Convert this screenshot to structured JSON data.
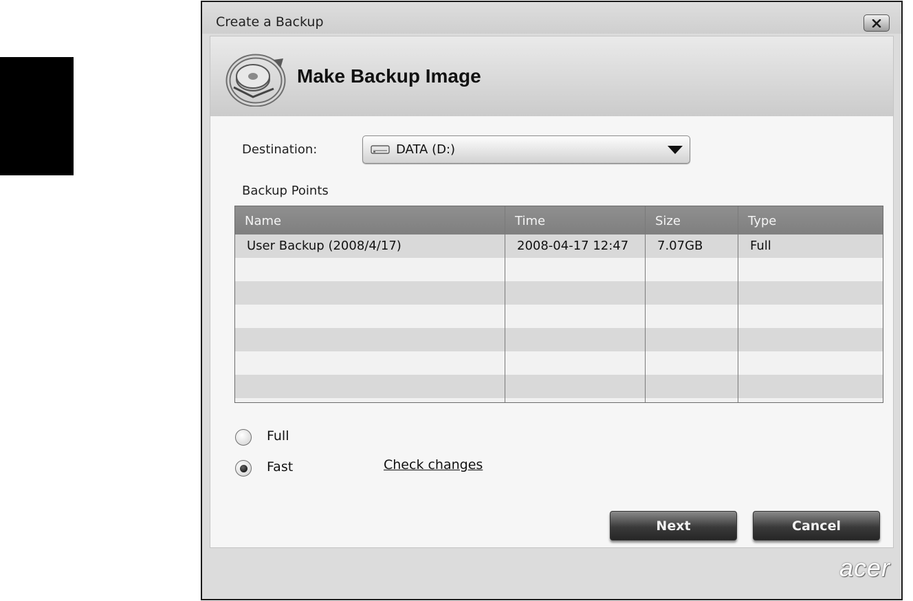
{
  "window": {
    "title": "Create a Backup",
    "close_icon": "close-x-icon"
  },
  "header": {
    "title": "Make Backup Image",
    "icon": "backup-disk-icon"
  },
  "destination": {
    "label": "Destination:",
    "value": "DATA (D:)",
    "icon": "drive-icon"
  },
  "backup_points": {
    "label": "Backup Points",
    "columns": [
      "Name",
      "Time",
      "Size",
      "Type"
    ],
    "rows": [
      {
        "name": "User Backup (2008/4/17)",
        "time": "2008-04-17 12:47",
        "size": "7.07GB",
        "type": "Full"
      }
    ]
  },
  "options": {
    "full_label": "Full",
    "fast_label": "Fast",
    "selected": "Fast",
    "check_changes": "Check changes"
  },
  "buttons": {
    "next": "Next",
    "cancel": "Cancel"
  },
  "brand": {
    "logo": "acer"
  }
}
